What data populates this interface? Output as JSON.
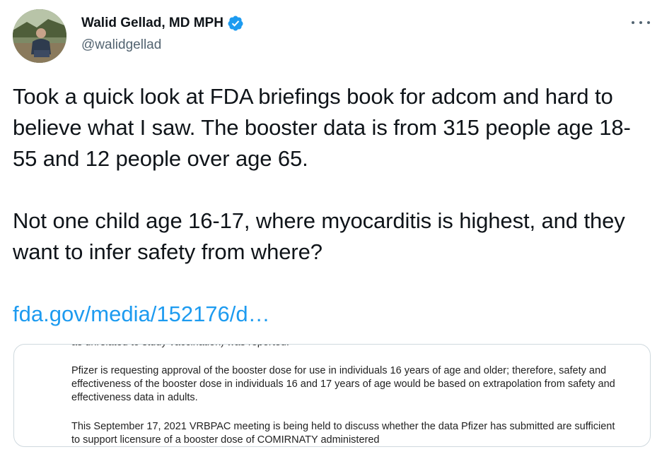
{
  "author": {
    "display_name": "Walid Gellad, MD MPH",
    "handle": "@walidgellad",
    "verified": true,
    "avatar": "profile-photo"
  },
  "menu_icon": "more-icon",
  "tweet": {
    "paragraph_1": "Took a quick look at FDA briefings book for adcom and hard to believe what I saw. The booster data is from 315 people age 18-55 and 12 people over age 65.",
    "paragraph_2": "Not one child age 16-17, where myocarditis is highest, and they want to infer safety from where?",
    "link": "fda.gov/media/152176/d…"
  },
  "card": {
    "cut_line": "as unrelated to study vaccination) was reported.",
    "paragraph_1": "Pfizer is requesting approval of the booster dose for use in individuals 16 years of age and older; therefore, safety and effectiveness of the booster dose in individuals 16 and 17 years of age would be based on extrapolation from safety and effectiveness data in adults.",
    "paragraph_2": "This September 17, 2021 VRBPAC meeting is being held to discuss whether the data Pfizer has submitted are sufficient to support licensure of a booster dose of COMIRNATY administered"
  },
  "colors": {
    "link": "#1d9bf0",
    "verified_badge": "#1d9bf0",
    "secondary_text": "#536471"
  }
}
